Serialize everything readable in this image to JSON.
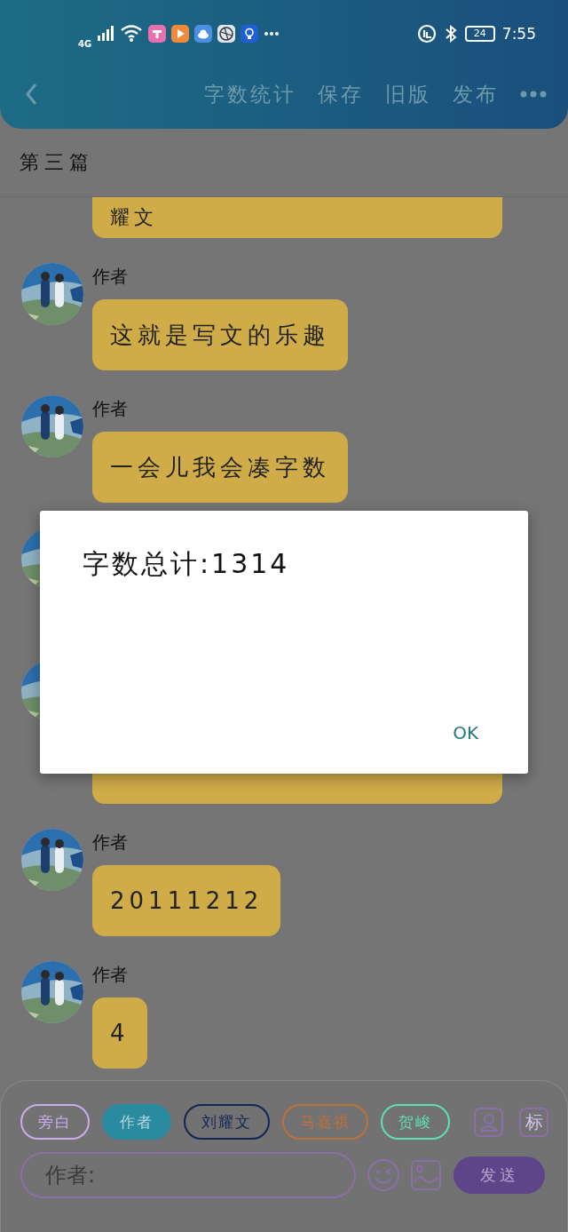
{
  "status_bar": {
    "network": "4G",
    "battery": "24",
    "time": "7:55"
  },
  "toolbar": {
    "actions": [
      {
        "label": "字数统计"
      },
      {
        "label": "保存"
      },
      {
        "label": "旧版"
      },
      {
        "label": "发布"
      }
    ]
  },
  "document": {
    "title": "第三篇"
  },
  "messages": [
    {
      "kind": "tail",
      "text": "耀文"
    },
    {
      "kind": "message",
      "author": "作者",
      "text": "这就是写文的乐趣"
    },
    {
      "kind": "message",
      "author": "作者",
      "text": "一会儿我会凑字数"
    },
    {
      "kind": "covered"
    },
    {
      "kind": "covered-long"
    },
    {
      "kind": "message",
      "author": "作者",
      "text": "20111212"
    },
    {
      "kind": "message",
      "author": "作者",
      "text": "4"
    }
  ],
  "roles": [
    {
      "label": "旁白",
      "color": "#c9adec",
      "selected": false
    },
    {
      "label": "作者",
      "color": "#2a8aa0",
      "selected": true
    },
    {
      "label": "刘耀文",
      "color": "#142457",
      "selected": false
    },
    {
      "label": "马嘉祺",
      "color": "#c0703a",
      "selected": false
    },
    {
      "label": "贺峻",
      "color": "#5fe0b4",
      "selected": false
    }
  ],
  "composer": {
    "mark_button": "标",
    "placeholder": "作者:",
    "send": "发送"
  },
  "dialog": {
    "message": "字数总计:1314",
    "button": "OK"
  }
}
